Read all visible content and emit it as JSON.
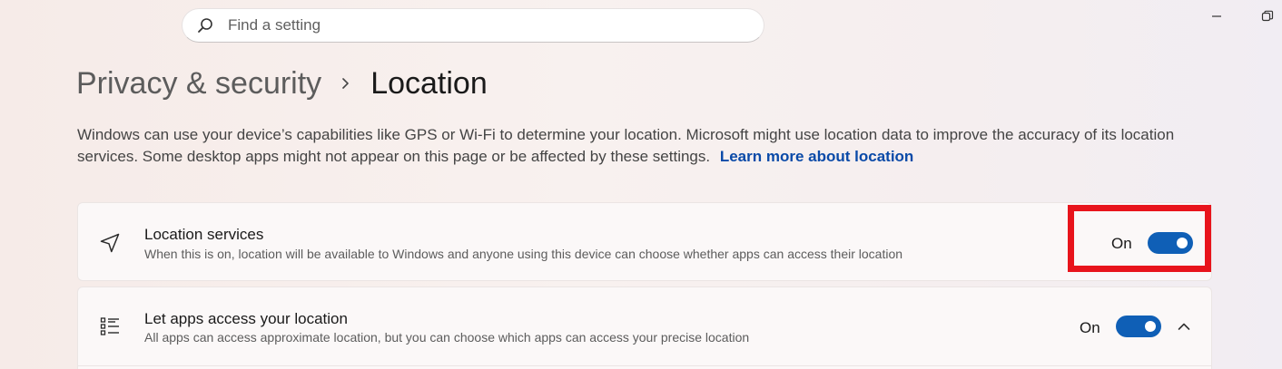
{
  "search": {
    "placeholder": "Find a setting",
    "icon": "search-icon"
  },
  "window_controls": {
    "minimize_icon": "minimize-icon",
    "restore_icon": "restore-icon"
  },
  "breadcrumb": {
    "parent": "Privacy & security",
    "separator_icon": "chevron-right-icon",
    "current": "Location"
  },
  "description": {
    "text": "Windows can use your device’s capabilities like GPS or Wi-Fi to determine your location. Microsoft might use location data to improve the accuracy of its location services. Some desktop apps might not appear on this page or be affected by these settings.",
    "link": "Learn more about location"
  },
  "settings": [
    {
      "icon": "location-arrow-icon",
      "title": "Location services",
      "subtitle": "When this is on, location will be available to Windows and anyone using this device can choose whether apps can access their location",
      "state_label": "On",
      "toggle_on": true
    },
    {
      "icon": "app-list-icon",
      "title": "Let apps access your location",
      "subtitle": "All apps can access approximate location, but you can choose which apps can access your precise location",
      "state_label": "On",
      "toggle_on": true,
      "expanded": true,
      "expand_icon": "chevron-up-icon"
    }
  ],
  "colors": {
    "accent": "#0f5fb6",
    "link": "#0a4aa8",
    "highlight": "#e8141c"
  }
}
